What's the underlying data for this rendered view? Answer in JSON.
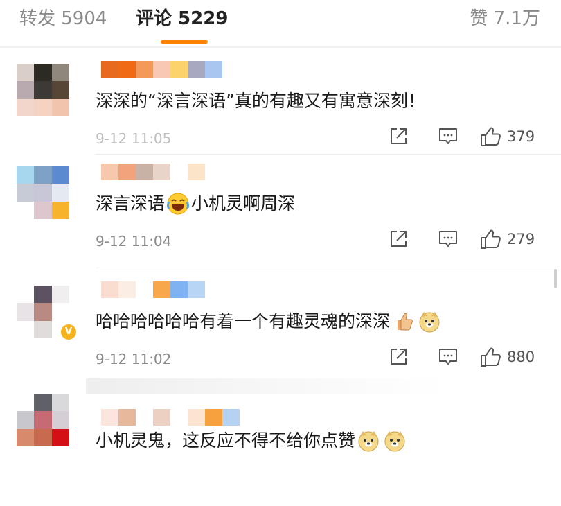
{
  "tabs": {
    "repost_label": "转发 5904",
    "comment_label": "评论 5229",
    "like_label": "赞 7.1万",
    "active_color": "#ff8200"
  },
  "comments": [
    {
      "text": "深深的“深言深语”真的有趣又有寓意深刻！",
      "time": "9-12 11:05",
      "likes": "379",
      "emojis": []
    },
    {
      "text_before": "深言深语",
      "emoji_1": "laugh-cry-emoji",
      "text_after": "小机灵啊周深",
      "time": "9-12 11:04",
      "likes": "279"
    },
    {
      "text": "哈哈哈哈哈哈有着一个有趣灵魂的深深",
      "emoji_1": "thumbs-up-emoji",
      "emoji_2": "doge-emoji",
      "time": "9-12 11:02",
      "likes": "880",
      "vip_badge": "V"
    },
    {
      "text": "小机灵鬼，这反应不得不给你点赞",
      "emoji_1": "doge-emoji",
      "emoji_2": "doge-emoji"
    }
  ],
  "icons": {
    "repost": "share-out-icon",
    "reply": "comment-bubble-icon",
    "like": "thumbs-up-icon"
  }
}
